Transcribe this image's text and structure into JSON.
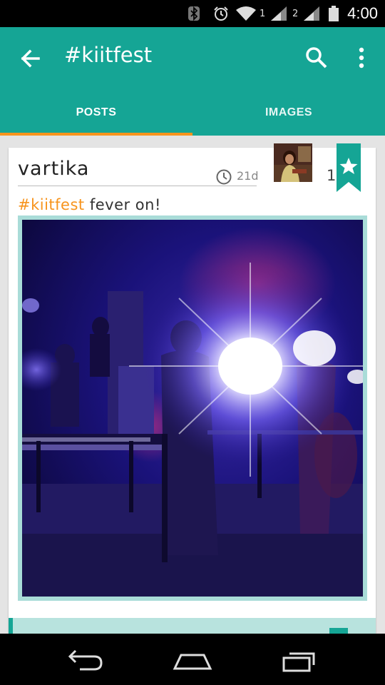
{
  "status_bar": {
    "time": "4:00",
    "sim1_label": "1",
    "sim2_label": "2",
    "icons": [
      "bluetooth-icon",
      "alarm-icon",
      "wifi-icon",
      "signal-icon",
      "battery-icon"
    ]
  },
  "app_bar": {
    "title": "#kiitfest",
    "icons": [
      "back-arrow-icon",
      "search-icon",
      "more-vert-icon"
    ],
    "color": "#15a595"
  },
  "tabs": [
    {
      "label": "POSTS",
      "selected": true
    },
    {
      "label": "IMAGES",
      "selected": false
    }
  ],
  "accent_color": "#f7941d",
  "post": {
    "username": "vartika",
    "age": "21d",
    "favorite_count": "1",
    "caption_tag": "#kiitfest",
    "caption_text": " fever on!"
  },
  "navigation": {
    "icons": [
      "back-nav-icon",
      "home-nav-icon",
      "recents-nav-icon"
    ]
  }
}
